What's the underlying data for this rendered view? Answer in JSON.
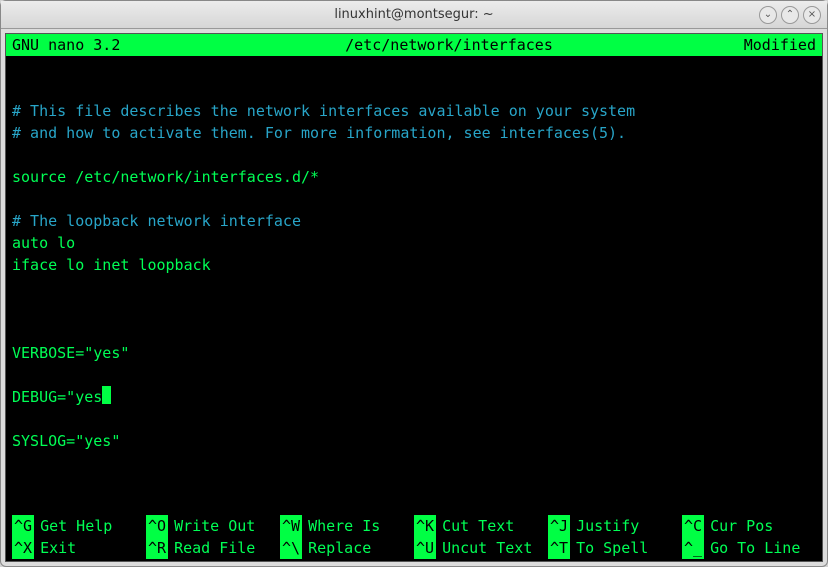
{
  "window": {
    "title": "linuxhint@montsegur: ~",
    "controls": {
      "minimize": "⌄",
      "maximize": "⌃",
      "close": "×"
    }
  },
  "nano": {
    "version": "GNU nano 3.2",
    "filepath": "/etc/network/interfaces",
    "status": "Modified"
  },
  "content": {
    "l1": "# This file describes the network interfaces available on your system",
    "l2": "# and how to activate them. For more information, see interfaces(5).",
    "l3": "",
    "l4": "source /etc/network/interfaces.d/*",
    "l5": "",
    "l6": "# The loopback network interface",
    "l7": "auto lo",
    "l8": "iface lo inet loopback",
    "l9": "",
    "l10": "",
    "l11": "",
    "l12": "VERBOSE=\"yes\"",
    "l13": "",
    "l14a": "DEBUG=\"yes",
    "l14b": "\"",
    "l15": "",
    "l16": "SYSLOG=\"yes\""
  },
  "shortcuts": {
    "row1": [
      {
        "key": "^G",
        "label": "Get Help"
      },
      {
        "key": "^O",
        "label": "Write Out"
      },
      {
        "key": "^W",
        "label": "Where Is"
      },
      {
        "key": "^K",
        "label": "Cut Text"
      },
      {
        "key": "^J",
        "label": "Justify"
      },
      {
        "key": "^C",
        "label": "Cur Pos"
      }
    ],
    "row2": [
      {
        "key": "^X",
        "label": "Exit"
      },
      {
        "key": "^R",
        "label": "Read File"
      },
      {
        "key": "^\\",
        "label": "Replace"
      },
      {
        "key": "^U",
        "label": "Uncut Text"
      },
      {
        "key": "^T",
        "label": "To Spell"
      },
      {
        "key": "^_",
        "label": "Go To Line"
      }
    ]
  }
}
